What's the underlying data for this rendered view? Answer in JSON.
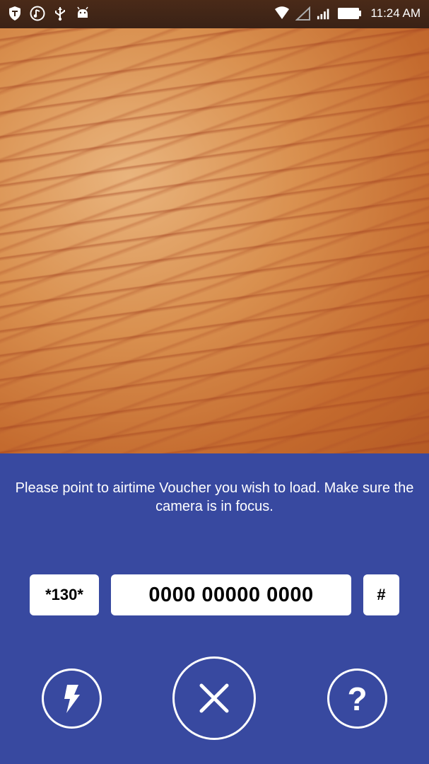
{
  "status_bar": {
    "time": "11:24 AM",
    "left_icons": [
      "shield-icon",
      "music-note-icon",
      "usb-icon",
      "android-icon"
    ],
    "right_icons": [
      "wifi-icon",
      "no-sim-signal-icon",
      "cell-signal-icon",
      "battery-icon"
    ]
  },
  "panel": {
    "background_color": "#3849a0",
    "instructions": "Please point to airtime Voucher you wish to load. Make sure the camera is in focus.",
    "code": {
      "prefix": "*130*",
      "voucher_number": "0000 00000 0000",
      "suffix": "#"
    },
    "help_label": "?"
  }
}
